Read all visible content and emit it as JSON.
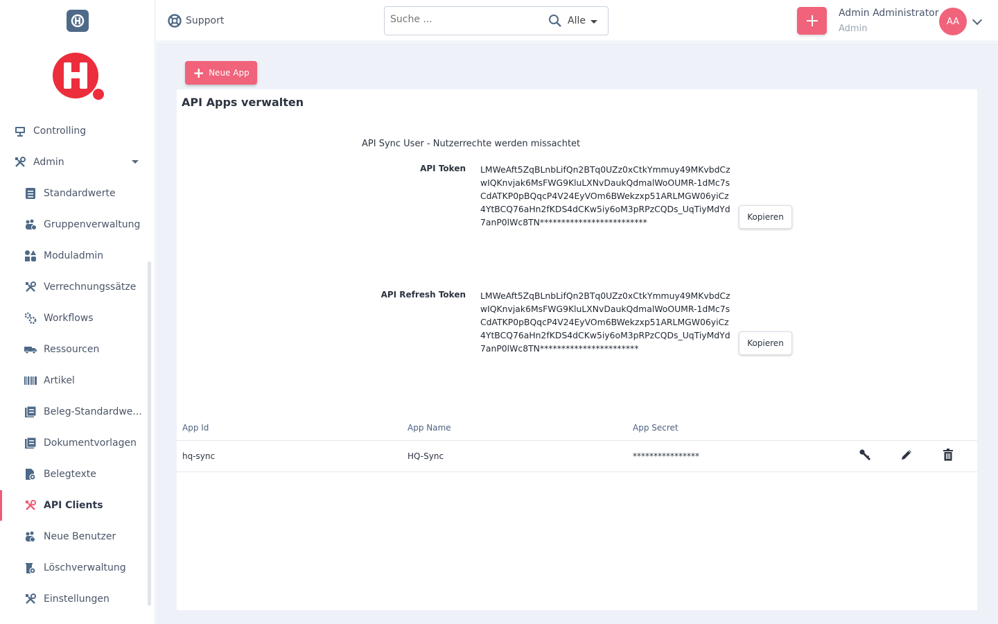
{
  "sidebar": {
    "items": [
      {
        "label": "Controlling"
      },
      {
        "label": "Admin"
      },
      {
        "label": "Standardwerte"
      },
      {
        "label": "Gruppenverwaltung"
      },
      {
        "label": "Moduladmin"
      },
      {
        "label": "Verrechnungssätze"
      },
      {
        "label": "Workflows"
      },
      {
        "label": "Ressourcen"
      },
      {
        "label": "Artikel"
      },
      {
        "label": "Beleg-Standardwe..."
      },
      {
        "label": "Dokumentvorlagen"
      },
      {
        "label": "Belegtexte"
      },
      {
        "label": "API Clients"
      },
      {
        "label": "Neue Benutzer"
      },
      {
        "label": "Löschverwaltung"
      },
      {
        "label": "Einstellungen"
      }
    ],
    "active_item": "API Clients"
  },
  "header": {
    "support_label": "Support",
    "search": {
      "placeholder": "Suche ...",
      "value": "",
      "scope": "Alle"
    },
    "user": {
      "name": "Admin Administrator",
      "role": "Admin",
      "initials": "AA"
    }
  },
  "main": {
    "new_app_label": "Neue App",
    "title": "API Apps verwalten",
    "sync_note": "API Sync User - Nutzerrechte werden missachtet",
    "api_token": {
      "label": "API Token",
      "value": "LMWeAft5ZqBLnbLifQn2BTq0UZz0xCtkYmmuy49MKvbdCzwIQKnvjak6MsFWG9KluLXNvDaukQdmalWoOUMR-1dMc7sCdATKP0pBQqcP4V24EyVOm6BWekzxp51ARLMGW06yiCz4YtBCQ76aHn2fKDS4dCKw5iy6oM3pRPzCQDs_UqTiyMdYd7anP0lWc8TN*************************",
      "copy_label": "Kopieren"
    },
    "api_refresh_token": {
      "label": "API Refresh Token",
      "value": "LMWeAft5ZqBLnbLifQn2BTq0UZz0xCtkYmmuy49MKvbdCzwIQKnvjak6MsFWG9KluLXNvDaukQdmalWoOUMR-1dMc7sCdATKP0pBQqcP4V24EyVOm6BWekzxp51ARLMGW06yiCz4YtBCQ76aHn2fKDS4dCKw5iy6oM3pRPzCQDs_UqTiyMdYd7anP0lWc8TN***********************",
      "copy_label": "Kopieren"
    },
    "table": {
      "columns": [
        "App Id",
        "App Name",
        "App Secret"
      ],
      "rows": [
        {
          "app_id": "hq-sync",
          "app_name": "HQ-Sync",
          "app_secret": "****************"
        }
      ]
    }
  },
  "colors": {
    "accent": "#f0637a",
    "brand": "#ec2d3c",
    "sidebar_icon": "#4f6a88"
  }
}
